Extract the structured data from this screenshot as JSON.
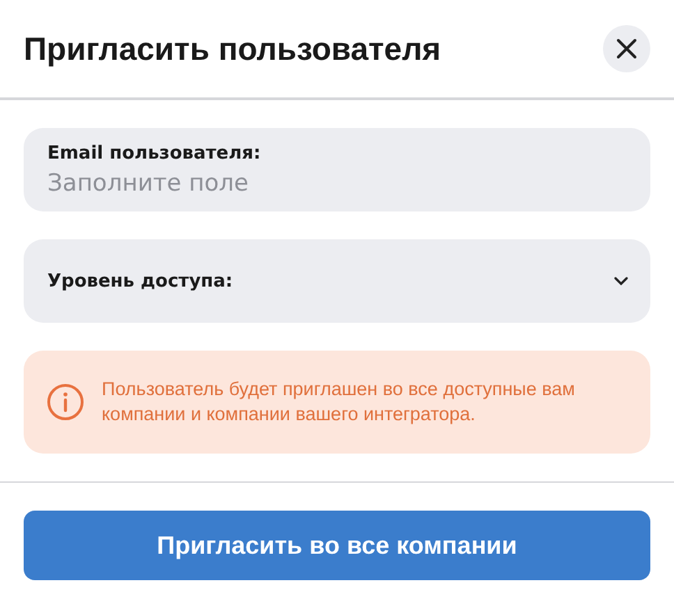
{
  "dialog": {
    "title": "Пригласить пользователя"
  },
  "fields": [
    {
      "kind": "input",
      "label": "Email пользователя:",
      "placeholder": "Заполните поле"
    },
    {
      "kind": "select",
      "label": "Уровень доступа:"
    }
  ],
  "notice": {
    "text": "Пользователь будет приглашен во все доступные вам компании и компании вашего интегратора."
  },
  "primary_button": {
    "label": "Пригласить во все компании"
  }
}
